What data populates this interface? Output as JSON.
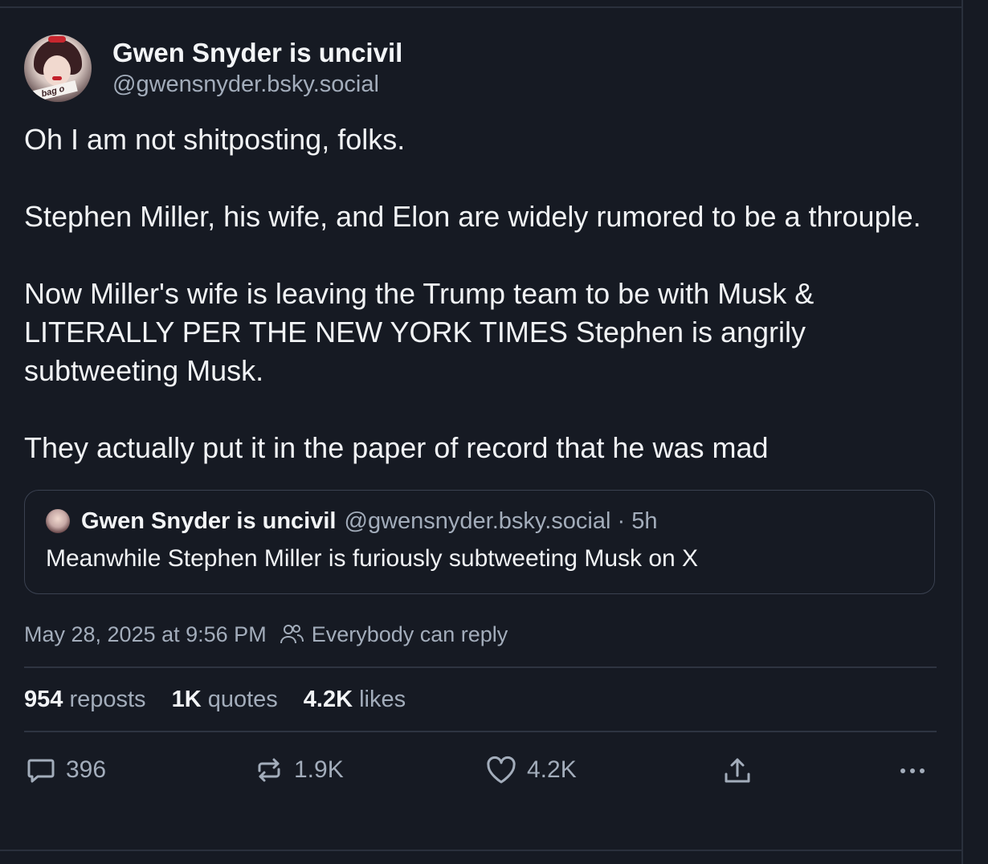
{
  "post": {
    "author": {
      "display_name": "Gwen Snyder is uncivil",
      "handle": "@gwensnyder.bsky.social",
      "avatar_text": "bag o"
    },
    "text": "Oh I am not shitposting, folks.\n\nStephen Miller, his wife, and Elon are widely rumored to be a throuple.\n\nNow Miller's wife is leaving the Trump team to be with Musk & LITERALLY PER THE NEW YORK TIMES Stephen is angrily subtweeting Musk.\n\nThey actually put it in the paper of record that he was mad",
    "quote": {
      "display_name": "Gwen Snyder is uncivil",
      "handle_time": "@gwensnyder.bsky.social · 5h",
      "text": "Meanwhile Stephen Miller is furiously subtweeting Musk on X"
    },
    "timestamp": "May 28, 2025 at 9:56 PM",
    "reply_setting": "Everybody can reply",
    "stats": {
      "reposts_num": "954",
      "reposts_label": "reposts",
      "quotes_num": "1K",
      "quotes_label": "quotes",
      "likes_num": "4.2K",
      "likes_label": "likes"
    },
    "actions": {
      "reply_count": "396",
      "repost_count": "1.9K",
      "like_count": "4.2K"
    }
  },
  "icons": {
    "reply": "comment-icon",
    "repost": "repost-icon",
    "like": "heart-icon",
    "share": "share-icon",
    "more": "more-icon",
    "audience": "people-icon"
  },
  "colors": {
    "background": "#161a23",
    "text": "#f1f3f5",
    "muted": "#a3adbb",
    "border": "#3a4150"
  }
}
